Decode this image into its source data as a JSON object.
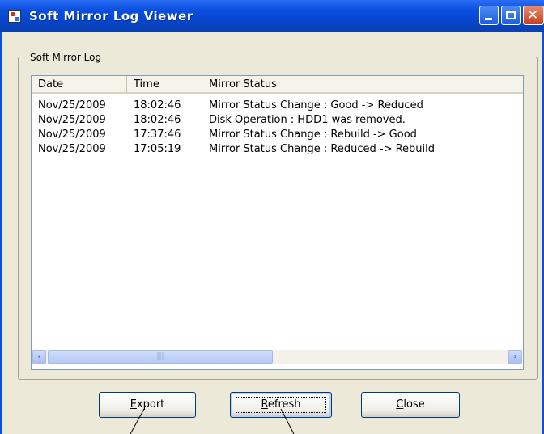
{
  "window": {
    "title": "Soft Mirror Log Viewer"
  },
  "group": {
    "label": "Soft Mirror Log"
  },
  "list": {
    "columns": [
      "Date",
      "Time",
      "Mirror Status"
    ],
    "rows": [
      [
        "Nov/25/2009",
        "18:02:46",
        "Mirror Status Change : Good -> Reduced"
      ],
      [
        "Nov/25/2009",
        "18:02:46",
        "Disk Operation : HDD1 was removed."
      ],
      [
        "Nov/25/2009",
        "17:37:46",
        "Mirror Status Change : Rebuild -> Good"
      ],
      [
        "Nov/25/2009",
        "17:05:19",
        "Mirror Status Change : Reduced -> Rebuild"
      ]
    ]
  },
  "buttons": {
    "export": {
      "accel": "E",
      "rest": "xport"
    },
    "refresh": {
      "accel": "R",
      "rest": "efresh"
    },
    "close": {
      "accel": "C",
      "rest": "lose"
    }
  },
  "icons": {
    "left_arrow": "‹",
    "right_arrow": "›",
    "grip": "|||"
  },
  "colors": {
    "titlebar": "#0a4fe0",
    "face": "#ece9d8"
  }
}
